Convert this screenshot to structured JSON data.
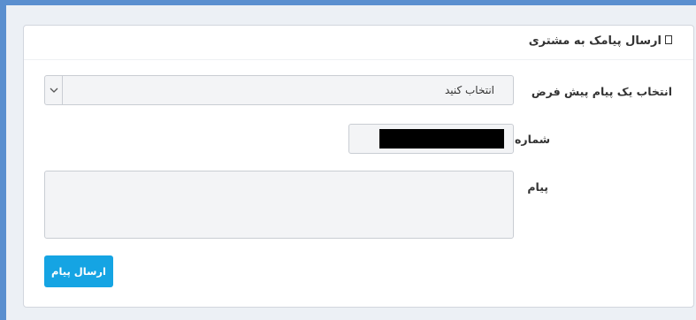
{
  "panel": {
    "title": "ارسال پیامک به مشتری",
    "title_icon": "square-icon"
  },
  "form": {
    "template_label": "انتخاب یک پیام پیش فرض",
    "template_selected": "انتخاب کنید",
    "phone_label": "شماره مشتری",
    "phone_value_redacted": true,
    "message_label": "پیام",
    "message_value": "",
    "send_label": "ارسال پیام"
  },
  "colors": {
    "accent": "#15a4e3",
    "frame": "#5a8fcf",
    "background": "#ecf0f5"
  }
}
